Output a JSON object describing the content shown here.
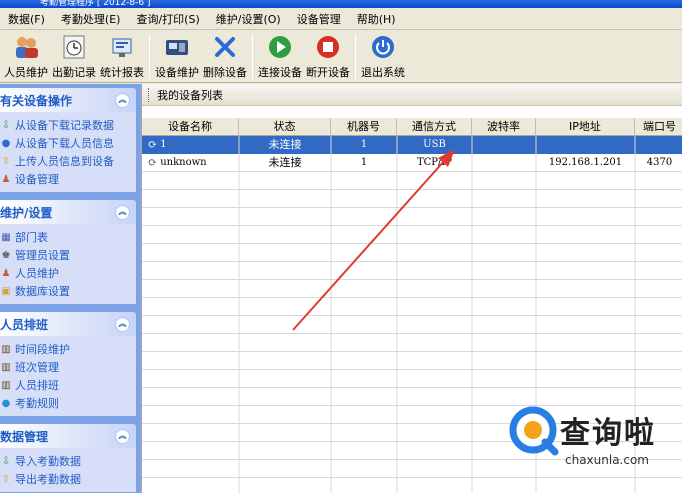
{
  "window": {
    "title": "考勤管理程序 [ 2012-8-6 ]"
  },
  "menu": [
    "数据(F)",
    "考勤处理(E)",
    "查询/打印(S)",
    "维护/设置(O)",
    "设备管理",
    "帮助(H)"
  ],
  "toolbar": [
    {
      "label": "人员维护",
      "icon": "people-icon"
    },
    {
      "label": "出勤记录",
      "icon": "clock-icon"
    },
    {
      "label": "统计报表",
      "icon": "report-icon"
    },
    {
      "label": "设备维护",
      "icon": "device-icon"
    },
    {
      "label": "删除设备",
      "icon": "delete-icon"
    },
    {
      "label": "连接设备",
      "icon": "connect-icon"
    },
    {
      "label": "断开设备",
      "icon": "disconnect-icon"
    },
    {
      "label": "退出系统",
      "icon": "power-icon"
    }
  ],
  "sidebar": {
    "panels": [
      {
        "title": "有关设备操作",
        "items": [
          "从设备下载记录数据",
          "从设备下载人员信息",
          "上传人员信息到设备",
          "设备管理"
        ]
      },
      {
        "title": "维护/设置",
        "items": [
          "部门表",
          "管理员设置",
          "人员维护",
          "数据库设置"
        ]
      },
      {
        "title": "人员排班",
        "items": [
          "时间段维护",
          "班次管理",
          "人员排班",
          "考勤规则"
        ]
      },
      {
        "title": "数据管理",
        "items": [
          "导入考勤数据",
          "导出考勤数据"
        ]
      }
    ]
  },
  "list": {
    "title": "我的设备列表",
    "columns": [
      "设备名称",
      "状态",
      "机器号",
      "通信方式",
      "波特率",
      "IP地址",
      "端口号"
    ],
    "rows": [
      {
        "name": "1",
        "status": "未连接",
        "machine": "1",
        "comm": "USB",
        "baud": "",
        "ip": "",
        "port": ""
      },
      {
        "name": "unknown",
        "status": "未连接",
        "machine": "1",
        "comm": "TCP/IP",
        "baud": "",
        "ip": "192.168.1.201",
        "port": "4370"
      }
    ]
  },
  "watermark": {
    "brand": "查询啦",
    "url": "chaxunla.com"
  },
  "colors": {
    "accent": "#215dc6",
    "selection": "#316ac5",
    "sidebar_bg": "#7ba2e7",
    "arrow": "#e03a2f"
  }
}
